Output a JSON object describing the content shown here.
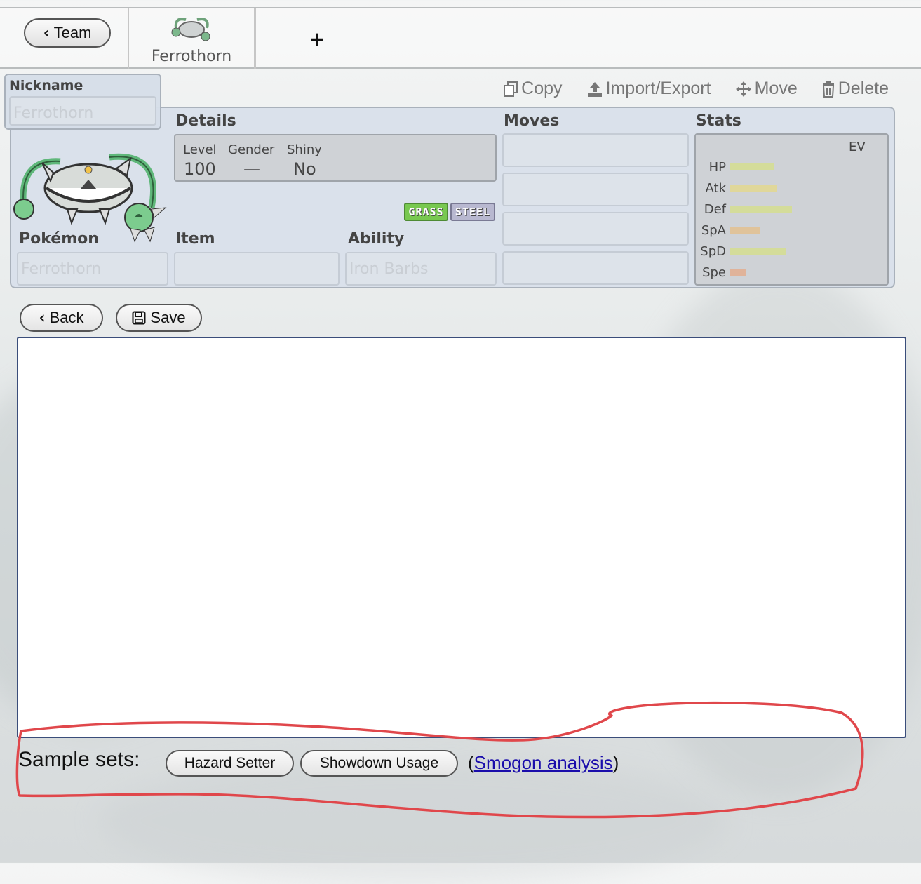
{
  "top_tabs": {
    "team_label": "Team",
    "pokemon_tab_label": "Ferrothorn",
    "add_tab_label": "+"
  },
  "actions": {
    "copy": "Copy",
    "import_export": "Import/Export",
    "move": "Move",
    "delete": "Delete"
  },
  "set": {
    "nickname_label": "Nickname",
    "nickname_placeholder": "Ferrothorn",
    "details_label": "Details",
    "level_label": "Level",
    "level_value": "100",
    "gender_label": "Gender",
    "gender_value": "—",
    "shiny_label": "Shiny",
    "shiny_value": "No",
    "types": [
      {
        "name": "GRASS",
        "color": "#78c850"
      },
      {
        "name": "STEEL",
        "color": "#b8b8d0"
      }
    ],
    "pokemon_label": "Pokémon",
    "pokemon_placeholder": "Ferrothorn",
    "item_label": "Item",
    "item_value": "",
    "ability_label": "Ability",
    "ability_placeholder": "Iron Barbs",
    "moves_label": "Moves",
    "moves": [
      "",
      "",
      "",
      ""
    ],
    "stats_label": "Stats",
    "ev_label": "EV",
    "stats": [
      {
        "name": "HP",
        "fill": 0.62,
        "color": "#d4dc9a"
      },
      {
        "name": "Atk",
        "fill": 0.67,
        "color": "#e0d79a"
      },
      {
        "name": "Def",
        "fill": 0.88,
        "color": "#d4dc9a"
      },
      {
        "name": "SpA",
        "fill": 0.43,
        "color": "#e0c39a"
      },
      {
        "name": "SpD",
        "fill": 0.8,
        "color": "#d4dc9a"
      },
      {
        "name": "Spe",
        "fill": 0.22,
        "color": "#e0b39a"
      }
    ]
  },
  "import_panel": {
    "back_label": "Back",
    "save_label": "Save",
    "text_value": ""
  },
  "samples": {
    "label": "Sample sets:",
    "sets": [
      "Hazard Setter",
      "Showdown Usage"
    ],
    "analysis_link": "Smogon analysis",
    "open_paren": "(",
    "close_paren": ")"
  },
  "annotation_color": "#e0474b"
}
